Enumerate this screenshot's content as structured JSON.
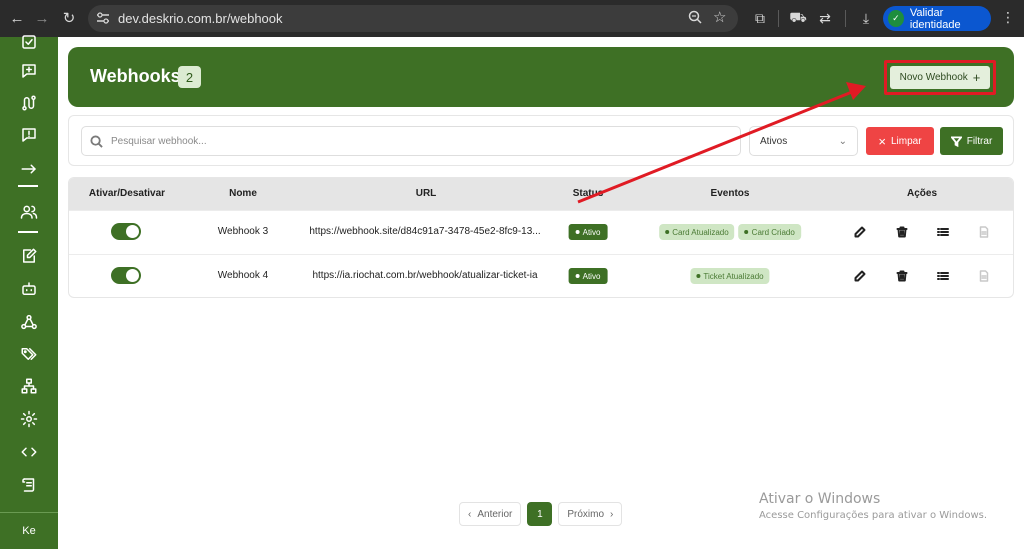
{
  "browser": {
    "url": "dev.deskrio.com.br/webhook",
    "validate_label": "Validar identidade"
  },
  "sidebar": {
    "icons": [
      "checkbox-icon",
      "message-plus-icon",
      "route-icon",
      "message-alert-icon",
      "arrow-right-icon",
      "users-icon",
      "edit-note-icon",
      "bot-icon",
      "webhook-icon",
      "tags-icon",
      "network-icon",
      "gear-icon",
      "code-icon",
      "scroll-icon"
    ],
    "avatar_initials": "Ke"
  },
  "header": {
    "title": "Webhooks",
    "count": "2",
    "new_button_label": "Novo Webhook",
    "new_button_icon": "+"
  },
  "filters": {
    "search_placeholder": "Pesquisar webhook...",
    "status_value": "Ativos",
    "clear_label": "Limpar",
    "clear_icon": "×",
    "filter_label": "Filtrar"
  },
  "table": {
    "columns": [
      "Ativar/Desativar",
      "Nome",
      "URL",
      "Status",
      "Eventos",
      "Ações"
    ],
    "rows": [
      {
        "enabled": true,
        "name": "Webhook 3",
        "url": "https://webhook.site/d84c91a7-3478-45e2-8fc9-13...",
        "status": "Ativo",
        "events": [
          "Card Atualizado",
          "Card Criado"
        ]
      },
      {
        "enabled": true,
        "name": "Webhook 4",
        "url": "https://ia.riochat.com.br/webhook/atualizar-ticket-ia",
        "status": "Ativo",
        "events": [
          "Ticket Atualizado"
        ]
      }
    ]
  },
  "pagination": {
    "prev_label": "Anterior",
    "next_label": "Próximo",
    "current_page": "1"
  },
  "watermark": {
    "title": "Ativar o Windows",
    "subtitle": "Acesse Configurações para ativar o Windows."
  },
  "colors": {
    "brand_green": "#3e7025",
    "danger_red": "#ef4444",
    "annotation_red": "#e01b24"
  }
}
